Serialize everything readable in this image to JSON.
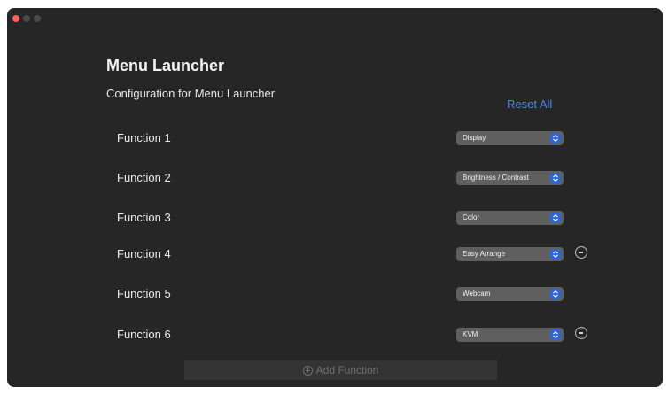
{
  "window": {
    "title": "Menu Launcher",
    "subtitle": "Configuration for Menu Launcher"
  },
  "actions": {
    "reset_all": "Reset All",
    "add_function": "Add Function"
  },
  "functions": [
    {
      "label": "Function 1",
      "selected": "Display",
      "removable": false
    },
    {
      "label": "Function 2",
      "selected": "Brightness / Contrast",
      "removable": false
    },
    {
      "label": "Function 3",
      "selected": "Color",
      "removable": false
    },
    {
      "label": "Function 4",
      "selected": "Easy Arrange",
      "removable": true
    },
    {
      "label": "Function 5",
      "selected": "Webcam",
      "removable": false
    },
    {
      "label": "Function 6",
      "selected": "KVM",
      "removable": true
    }
  ],
  "colors": {
    "window_bg": "#262626",
    "accent": "#2f66d6",
    "link": "#4a86e8",
    "close_dot": "#ff5f57"
  },
  "icons": {
    "close": "close-dot-icon",
    "minimize": "minimize-dot-icon",
    "zoom": "zoom-dot-icon",
    "chevron": "chevron-updown-icon",
    "remove": "minus-circle-icon",
    "add": "plus-circle-icon"
  }
}
